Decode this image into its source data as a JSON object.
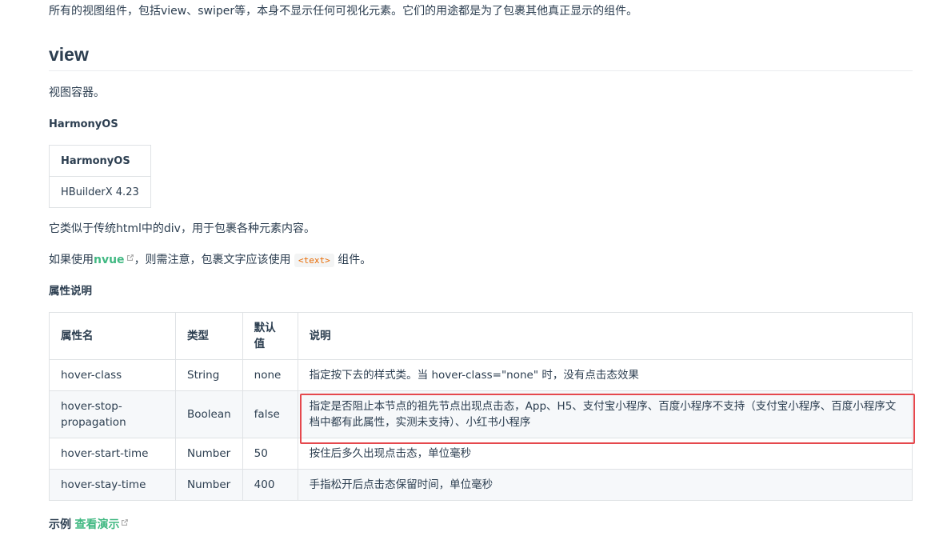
{
  "intro": "所有的视图组件，包括view、swiper等，本身不显示任何可视化元素。它们的用途都是为了包裹其他真正显示的组件。",
  "section_title": "view",
  "desc1": "视图容器。",
  "platform_heading": "HarmonyOS",
  "platform_table": {
    "header": "HarmonyOS",
    "value": "HBuilderX 4.23"
  },
  "desc2": "它类似于传统html中的div，用于包裹各种元素内容。",
  "nvue": {
    "prefix": "如果使用",
    "link": "nvue",
    "middle": "，则需注意，包裹文字应该使用",
    "code": "<text>",
    "suffix": "组件。"
  },
  "attr_heading": "属性说明",
  "attr_table": {
    "headers": [
      "属性名",
      "类型",
      "默认值",
      "说明"
    ],
    "rows": [
      [
        "hover-class",
        "String",
        "none",
        "指定按下去的样式类。当 hover-class=\"none\" 时，没有点击态效果"
      ],
      [
        "hover-stop-propagation",
        "Boolean",
        "false",
        "指定是否阻止本节点的祖先节点出现点击态，App、H5、支付宝小程序、百度小程序不支持（支付宝小程序、百度小程序文档中都有此属性，实测未支持）、小红书小程序"
      ],
      [
        "hover-start-time",
        "Number",
        "50",
        "按住后多久出现点击态，单位毫秒"
      ],
      [
        "hover-stay-time",
        "Number",
        "400",
        "手指松开后点击态保留时间，单位毫秒"
      ]
    ]
  },
  "example": {
    "label": "示例",
    "link": "查看演示"
  },
  "colors": {
    "link": "#42b983",
    "highlight": "#e5484d",
    "code": "#e96900"
  }
}
